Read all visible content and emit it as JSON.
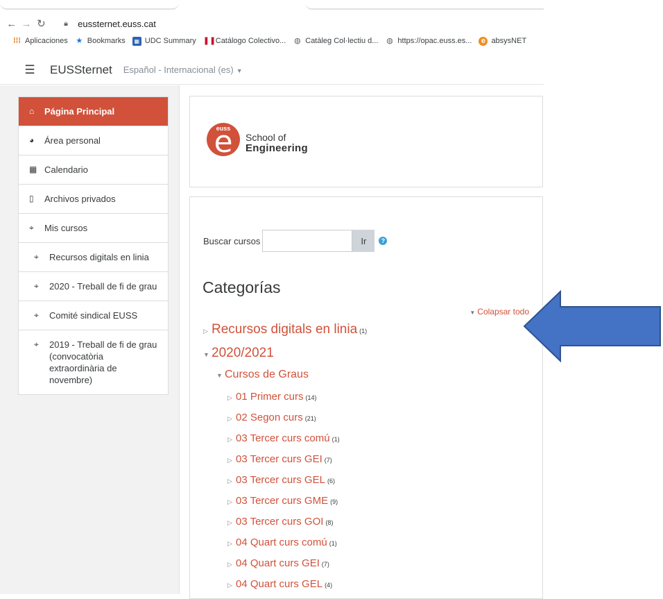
{
  "browser": {
    "url": "eussternet.euss.cat",
    "bookmarks": [
      {
        "label": "Aplicaciones",
        "icon": "apps-grid-icon"
      },
      {
        "label": "Bookmarks",
        "icon": "star-icon"
      },
      {
        "label": "UDC Summary",
        "icon": "udc-icon"
      },
      {
        "label": "Catálogo Colectivo...",
        "icon": "catalogo-icon"
      },
      {
        "label": "Catàleg Col·lectiu d...",
        "icon": "globe-icon"
      },
      {
        "label": "https://opac.euss.es...",
        "icon": "globe-icon"
      },
      {
        "label": "absysNET",
        "icon": "absys-icon"
      }
    ]
  },
  "navbar": {
    "site_name": "EUSSternet",
    "language": "Español - Internacional (es)"
  },
  "drawer": {
    "items": [
      {
        "label": "Página Principal",
        "icon": "home-icon",
        "active": true
      },
      {
        "label": "Área personal",
        "icon": "dashboard-icon"
      },
      {
        "label": "Calendario",
        "icon": "calendar-icon"
      },
      {
        "label": "Archivos privados",
        "icon": "file-icon"
      },
      {
        "label": "Mis cursos",
        "icon": "graduation-cap-icon"
      },
      {
        "label": "Recursos digitals en linia",
        "icon": "graduation-cap-icon"
      },
      {
        "label": "2020 - Treball de fi de grau",
        "icon": "graduation-cap-icon"
      },
      {
        "label": "Comité sindical EUSS",
        "icon": "graduation-cap-icon"
      },
      {
        "label": "2019 - Treball de fi de grau (convocatòria extraordinària de novembre)",
        "icon": "graduation-cap-icon"
      }
    ]
  },
  "logo": {
    "badge": "euss",
    "letter": "e",
    "line1": "School of",
    "line2": "Engineering"
  },
  "search": {
    "label": "Buscar cursos",
    "button": "Ir",
    "value": ""
  },
  "categories": {
    "heading": "Categorías",
    "collapse_all": "Colapsar todo",
    "tree": [
      {
        "label": "Recursos digitals en linia",
        "count": "(1)",
        "expanded": false,
        "level": 0
      },
      {
        "label": "2020/2021",
        "count": "",
        "expanded": true,
        "level": 0
      },
      {
        "label": "Cursos de Graus",
        "count": "",
        "expanded": true,
        "level": 1
      },
      {
        "label": "01 Primer curs",
        "count": "(14)",
        "expanded": false,
        "level": 2
      },
      {
        "label": "02 Segon curs",
        "count": "(21)",
        "expanded": false,
        "level": 2
      },
      {
        "label": "03 Tercer curs comú",
        "count": "(1)",
        "expanded": false,
        "level": 2
      },
      {
        "label": "03 Tercer curs GEI",
        "count": "(7)",
        "expanded": false,
        "level": 2
      },
      {
        "label": "03 Tercer curs GEL",
        "count": "(6)",
        "expanded": false,
        "level": 2
      },
      {
        "label": "03 Tercer curs GME",
        "count": "(9)",
        "expanded": false,
        "level": 2
      },
      {
        "label": "03 Tercer curs GOI",
        "count": "(8)",
        "expanded": false,
        "level": 2
      },
      {
        "label": "04 Quart curs comú",
        "count": "(1)",
        "expanded": false,
        "level": 2
      },
      {
        "label": "04 Quart curs GEI",
        "count": "(7)",
        "expanded": false,
        "level": 2
      },
      {
        "label": "04 Quart curs GEL",
        "count": "(4)",
        "expanded": false,
        "level": 2
      }
    ]
  },
  "colors": {
    "accent": "#d1513a",
    "arrow_fill": "#4472c4",
    "arrow_stroke": "#2f528f"
  }
}
